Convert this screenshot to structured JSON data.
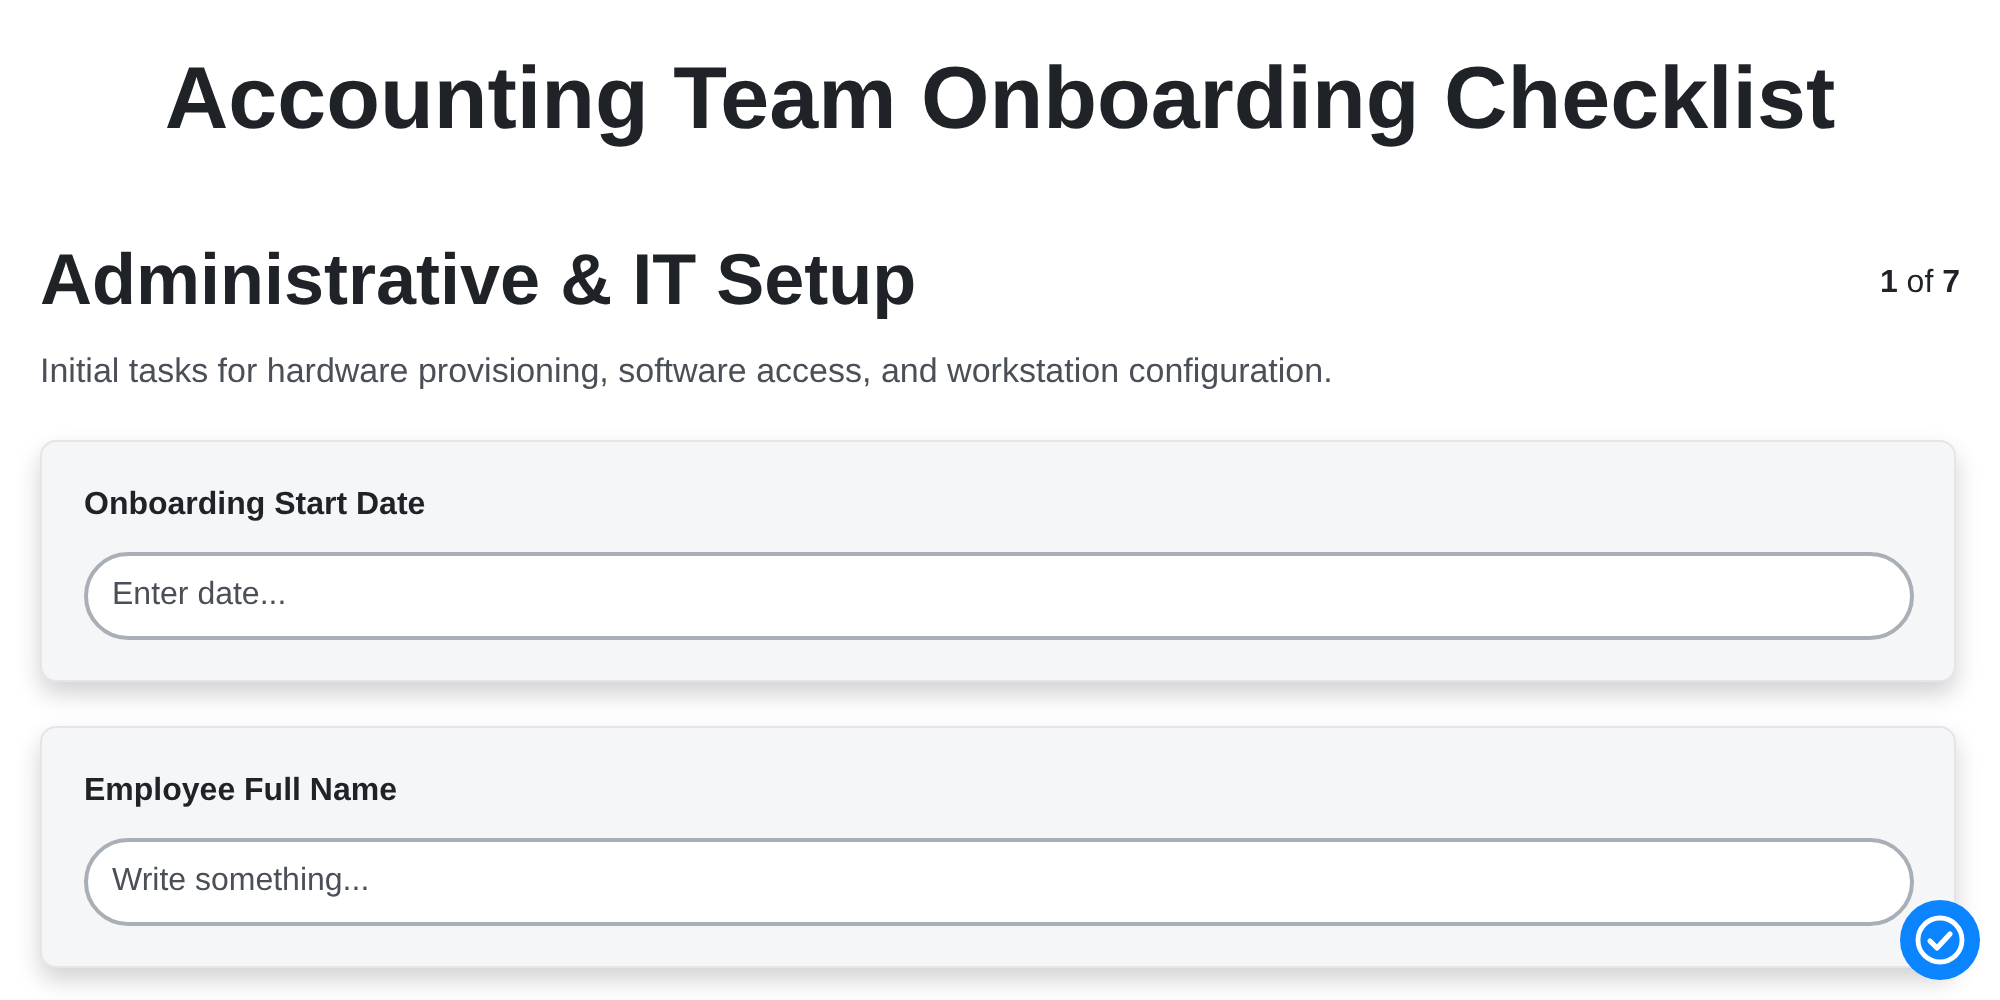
{
  "title": "Accounting Team Onboarding Checklist",
  "section": {
    "heading": "Administrative & IT Setup",
    "counter": "**1** of **7**",
    "description": "Initial tasks for hardware provisioning, software access, and workstation configuration."
  },
  "fields": [
    {
      "label": "Onboarding Start Date",
      "placeholder": "Enter date..."
    },
    {
      "label": "Employee Full Name",
      "placeholder": "Write something..."
    }
  ]
}
